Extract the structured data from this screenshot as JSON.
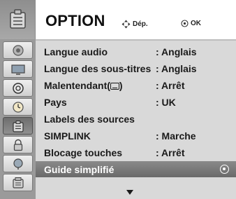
{
  "header": {
    "title": "OPTION",
    "hint_move": "Dép.",
    "hint_ok": "OK"
  },
  "sidebar": {
    "head_icon": "option-toolbox-icon",
    "items": [
      {
        "icon": "audio-speaker-icon"
      },
      {
        "icon": "picture-screen-icon"
      },
      {
        "icon": "screen-adjust-icon"
      },
      {
        "icon": "clock-icon"
      },
      {
        "icon": "option-icon",
        "active": true
      },
      {
        "icon": "lock-icon"
      },
      {
        "icon": "input-icon"
      },
      {
        "icon": "more-icon"
      }
    ]
  },
  "menu": {
    "items": [
      {
        "label": "Langue audio",
        "value": ": Anglais"
      },
      {
        "label": "Langue des sous-titres",
        "value": ": Anglais"
      },
      {
        "label": "Malentendant(",
        "label_suffix": ")",
        "value": ": Arrêt"
      },
      {
        "label": "Pays",
        "value": ": UK"
      },
      {
        "label": "Labels des sources",
        "value": ""
      },
      {
        "label": "SIMPLINK",
        "value": ": Marche"
      },
      {
        "label": "Blocage touches",
        "value": ": Arrêt"
      },
      {
        "label": "Guide simplifié",
        "value": "",
        "selected": true
      }
    ]
  },
  "colors": {
    "sidebar": "#9a9a9a",
    "menu_bg": "#d9d9d9",
    "selected_row": "#7a7a7a",
    "header_bg": "#ffffff"
  }
}
